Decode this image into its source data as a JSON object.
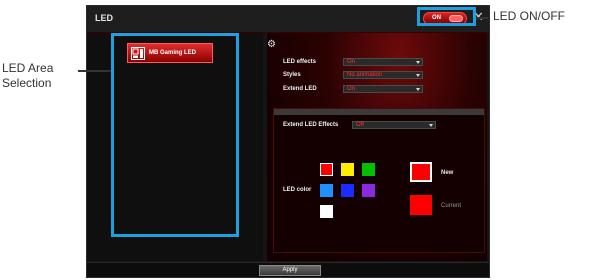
{
  "window": {
    "title": "LED"
  },
  "power_switch": {
    "label": "ON"
  },
  "close_icon": "close-icon",
  "led_area": {
    "button_label": "MB Gaming LED"
  },
  "settings": {
    "gear_icon": "gear-icon",
    "rows": [
      {
        "label": "LED effects",
        "value": "On"
      },
      {
        "label": "Styles",
        "value": "No animation"
      },
      {
        "label": "Extend LED",
        "value": "On"
      }
    ],
    "extend_led_effects": {
      "label": "Extend LED Effects",
      "value": "Off"
    },
    "led_color": {
      "label": "LED color",
      "swatches": [
        "#ff0000",
        "#ffee00",
        "#00c000",
        "#1e90ff",
        "#1c2cff",
        "#8a2be2",
        "#ffffff"
      ],
      "new_label": "New",
      "current_label": "Current",
      "new_color": "#ff0000",
      "current_color": "#ff0000"
    }
  },
  "footer": {
    "apply_label": "Apply"
  },
  "callouts": {
    "left": "LED Area\nSelection",
    "right": "LED ON/OFF"
  },
  "accent_color": "#1e9fe0"
}
